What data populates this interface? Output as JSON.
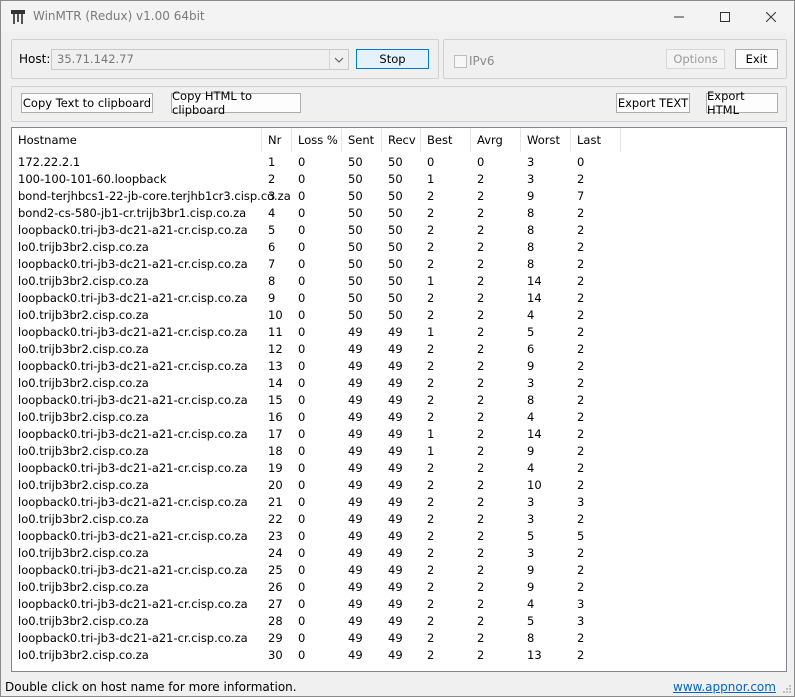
{
  "window": {
    "title": "WinMTR (Redux) v1.00 64bit"
  },
  "toolbar": {
    "host_label": "Host:",
    "host_value": "35.71.142.77",
    "stop_label": "Stop",
    "ipv6_label": "IPv6",
    "ipv6_checked": false,
    "options_label": "Options",
    "exit_label": "Exit",
    "copy_text_label": "Copy Text to clipboard",
    "copy_html_label": "Copy HTML to clipboard",
    "export_text_label": "Export TEXT",
    "export_html_label": "Export HTML"
  },
  "table": {
    "columns": [
      "Hostname",
      "Nr",
      "Loss %",
      "Sent",
      "Recv",
      "Best",
      "Avrg",
      "Worst",
      "Last"
    ],
    "rows": [
      [
        "172.22.2.1",
        "1",
        "0",
        "50",
        "50",
        "0",
        "0",
        "3",
        "0"
      ],
      [
        "100-100-101-60.loopback",
        "2",
        "0",
        "50",
        "50",
        "1",
        "2",
        "3",
        "2"
      ],
      [
        "bond-terjhbcs1-22-jb-core.terjhb1cr3.cisp.co.za",
        "3",
        "0",
        "50",
        "50",
        "2",
        "2",
        "9",
        "7"
      ],
      [
        "bond2-cs-580-jb1-cr.trijb3br1.cisp.co.za",
        "4",
        "0",
        "50",
        "50",
        "2",
        "2",
        "8",
        "2"
      ],
      [
        "loopback0.tri-jb3-dc21-a21-cr.cisp.co.za",
        "5",
        "0",
        "50",
        "50",
        "2",
        "2",
        "8",
        "2"
      ],
      [
        "lo0.trijb3br2.cisp.co.za",
        "6",
        "0",
        "50",
        "50",
        "2",
        "2",
        "8",
        "2"
      ],
      [
        "loopback0.tri-jb3-dc21-a21-cr.cisp.co.za",
        "7",
        "0",
        "50",
        "50",
        "2",
        "2",
        "8",
        "2"
      ],
      [
        "lo0.trijb3br2.cisp.co.za",
        "8",
        "0",
        "50",
        "50",
        "1",
        "2",
        "14",
        "2"
      ],
      [
        "loopback0.tri-jb3-dc21-a21-cr.cisp.co.za",
        "9",
        "0",
        "50",
        "50",
        "2",
        "2",
        "14",
        "2"
      ],
      [
        "lo0.trijb3br2.cisp.co.za",
        "10",
        "0",
        "50",
        "50",
        "2",
        "2",
        "4",
        "2"
      ],
      [
        "loopback0.tri-jb3-dc21-a21-cr.cisp.co.za",
        "11",
        "0",
        "49",
        "49",
        "1",
        "2",
        "5",
        "2"
      ],
      [
        "lo0.trijb3br2.cisp.co.za",
        "12",
        "0",
        "49",
        "49",
        "2",
        "2",
        "6",
        "2"
      ],
      [
        "loopback0.tri-jb3-dc21-a21-cr.cisp.co.za",
        "13",
        "0",
        "49",
        "49",
        "2",
        "2",
        "9",
        "2"
      ],
      [
        "lo0.trijb3br2.cisp.co.za",
        "14",
        "0",
        "49",
        "49",
        "2",
        "2",
        "3",
        "2"
      ],
      [
        "loopback0.tri-jb3-dc21-a21-cr.cisp.co.za",
        "15",
        "0",
        "49",
        "49",
        "2",
        "2",
        "8",
        "2"
      ],
      [
        "lo0.trijb3br2.cisp.co.za",
        "16",
        "0",
        "49",
        "49",
        "2",
        "2",
        "4",
        "2"
      ],
      [
        "loopback0.tri-jb3-dc21-a21-cr.cisp.co.za",
        "17",
        "0",
        "49",
        "49",
        "1",
        "2",
        "14",
        "2"
      ],
      [
        "lo0.trijb3br2.cisp.co.za",
        "18",
        "0",
        "49",
        "49",
        "1",
        "2",
        "9",
        "2"
      ],
      [
        "loopback0.tri-jb3-dc21-a21-cr.cisp.co.za",
        "19",
        "0",
        "49",
        "49",
        "2",
        "2",
        "4",
        "2"
      ],
      [
        "lo0.trijb3br2.cisp.co.za",
        "20",
        "0",
        "49",
        "49",
        "2",
        "2",
        "10",
        "2"
      ],
      [
        "loopback0.tri-jb3-dc21-a21-cr.cisp.co.za",
        "21",
        "0",
        "49",
        "49",
        "2",
        "2",
        "3",
        "3"
      ],
      [
        "lo0.trijb3br2.cisp.co.za",
        "22",
        "0",
        "49",
        "49",
        "2",
        "2",
        "3",
        "2"
      ],
      [
        "loopback0.tri-jb3-dc21-a21-cr.cisp.co.za",
        "23",
        "0",
        "49",
        "49",
        "2",
        "2",
        "5",
        "5"
      ],
      [
        "lo0.trijb3br2.cisp.co.za",
        "24",
        "0",
        "49",
        "49",
        "2",
        "2",
        "3",
        "2"
      ],
      [
        "loopback0.tri-jb3-dc21-a21-cr.cisp.co.za",
        "25",
        "0",
        "49",
        "49",
        "2",
        "2",
        "9",
        "2"
      ],
      [
        "lo0.trijb3br2.cisp.co.za",
        "26",
        "0",
        "49",
        "49",
        "2",
        "2",
        "9",
        "2"
      ],
      [
        "loopback0.tri-jb3-dc21-a21-cr.cisp.co.za",
        "27",
        "0",
        "49",
        "49",
        "2",
        "2",
        "4",
        "3"
      ],
      [
        "lo0.trijb3br2.cisp.co.za",
        "28",
        "0",
        "49",
        "49",
        "2",
        "2",
        "5",
        "3"
      ],
      [
        "loopback0.tri-jb3-dc21-a21-cr.cisp.co.za",
        "29",
        "0",
        "49",
        "49",
        "2",
        "2",
        "8",
        "2"
      ],
      [
        "lo0.trijb3br2.cisp.co.za",
        "30",
        "0",
        "49",
        "49",
        "2",
        "2",
        "13",
        "2"
      ]
    ]
  },
  "status": {
    "message": "Double click on host name for more information.",
    "link": "www.appnor.com"
  },
  "icons": {
    "app": "winmtr-app-icon",
    "minimize": "minimize-icon",
    "maximize": "maximize-icon",
    "close": "close-icon",
    "dropdown": "chevron-down-icon",
    "grip": "resize-grip-icon"
  },
  "colors": {
    "accent": "#0078d7",
    "link": "#0066cc"
  }
}
